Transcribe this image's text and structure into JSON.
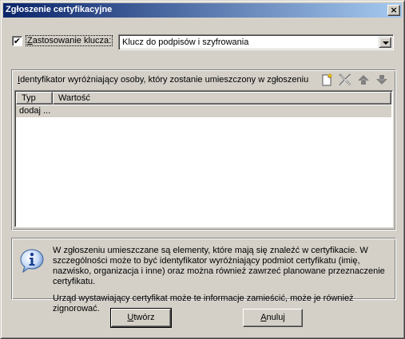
{
  "window": {
    "title": "Zgłoszenie certyfikacyjne",
    "close_glyph": "×"
  },
  "key_usage": {
    "checkbox_checked": true,
    "checkbox_glyph": "✔",
    "label_first": "Z",
    "label_rest": "astosowanie klucza:",
    "selected": "Klucz do podpisów i szyfrowania"
  },
  "identifiers": {
    "label_first": "I",
    "label_rest": "dentyfikator wyróżniający osoby, który zostanie umieszczony w zgłoszeniu",
    "toolbar": [
      "new-icon",
      "delete-icon",
      "move-up-icon",
      "move-down-icon"
    ],
    "columns": [
      "Typ",
      "Wartość"
    ],
    "rows": [
      {
        "typ": "dodaj ...",
        "wartosc": ""
      }
    ]
  },
  "info": {
    "icon": "info-icon",
    "paragraph1": "W zgłoszeniu umieszczane są elementy, które mają się znaleźć w certyfikacie. W szczególności może to być identyfikator wyróżniający podmiot certyfikatu (imię, nazwisko, organizacja i inne) oraz można również zawrzeć planowane przeznaczenie certyfikatu.",
    "paragraph2": "Urząd wystawiający certyfikat może te informacje zamieścić, może je również zignorować."
  },
  "buttons": {
    "create_first": "U",
    "create_rest": "twórz",
    "cancel_first": "A",
    "cancel_rest": "nuluj"
  },
  "colors": {
    "title_start": "#0a246a",
    "title_end": "#a6caf0",
    "face": "#d4d0c8"
  }
}
